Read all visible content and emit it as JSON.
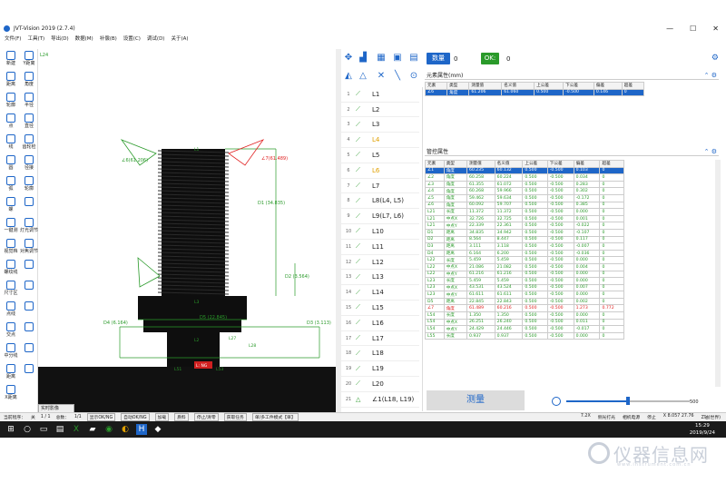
{
  "app": {
    "title": "JVT-Vision 2019   (2.7.4)",
    "window_controls": [
      "—",
      "☐",
      "✕"
    ]
  },
  "menu": [
    "文件(F)",
    "工具(T)",
    "导出(D)",
    "数据(M)",
    "补偿(B)",
    "设置(C)",
    "调试(D)",
    "关于(A)"
  ],
  "left_tools": [
    {
      "label": "新建",
      "icon": "new-icon"
    },
    {
      "label": "Y距离",
      "icon": "y-distance-icon"
    },
    {
      "label": "距离",
      "icon": "distance-icon"
    },
    {
      "label": "角度",
      "icon": "angle-icon"
    },
    {
      "label": "轮廓",
      "icon": "contour-icon"
    },
    {
      "label": "半径",
      "icon": "radius-icon"
    },
    {
      "label": "点",
      "icon": "point-icon"
    },
    {
      "label": "直径",
      "icon": "diameter-icon"
    },
    {
      "label": "线",
      "icon": "line-icon"
    },
    {
      "label": "齿轮检",
      "icon": "gear-check-icon"
    },
    {
      "label": "圆",
      "icon": "circle-icon"
    },
    {
      "label": "径接",
      "icon": "tangent-icon"
    },
    {
      "label": "弧",
      "icon": "arc-icon"
    },
    {
      "label": "轮廓",
      "icon": "profile-icon"
    },
    {
      "label": "螺",
      "icon": "thread-icon"
    },
    {
      "label": "",
      "icon": "blank-icon"
    },
    {
      "label": "一键测",
      "icon": "one-click-icon"
    },
    {
      "label": "灯光调节",
      "icon": "light-icon"
    },
    {
      "label": "视觉档",
      "icon": "visual-icon"
    },
    {
      "label": "对焦调节",
      "icon": "focus-icon"
    },
    {
      "label": "螺纹线",
      "icon": "thread-line-icon"
    },
    {
      "label": "",
      "icon": "chart-icon"
    },
    {
      "label": "尺寸区",
      "icon": "dimension-area-icon"
    },
    {
      "label": "",
      "icon": "x-icon"
    },
    {
      "label": "点线",
      "icon": "dotline-icon"
    },
    {
      "label": "",
      "icon": "x2-icon"
    },
    {
      "label": "交点",
      "icon": "intersect-icon"
    },
    {
      "label": "",
      "icon": "blank2-icon"
    },
    {
      "label": "中分线",
      "icon": "bisector-icon"
    },
    {
      "label": "",
      "icon": "blank3-icon"
    },
    {
      "label": "距离",
      "icon": "distance2-icon"
    },
    {
      "label": "",
      "icon": "blank4-icon"
    },
    {
      "label": "X距离",
      "icon": "x-distance-icon"
    }
  ],
  "view": {
    "corner_label": "L24",
    "annotations": [
      {
        "t": "∠6(61.206)",
        "c": "#2a9a2a"
      },
      {
        "t": "∠7(61.489)",
        "c": "#e02020"
      },
      {
        "t": "D1 (34.835)",
        "c": "#2a9a2a"
      },
      {
        "t": "D2 (3.564)",
        "c": "#2a9a2a"
      },
      {
        "t": "D4 (6.164)",
        "c": "#2a9a2a"
      },
      {
        "t": "D3 (3.113)",
        "c": "#2a9a2a"
      },
      {
        "t": "D5 (22.845)",
        "c": "#2a9a2a"
      },
      {
        "t": "L1",
        "c": "#2a9a2a"
      },
      {
        "t": "L2",
        "c": "#2a9a2a"
      },
      {
        "t": "L3",
        "c": "#2a9a2a"
      },
      {
        "t": "L51",
        "c": "#2a9a2a"
      },
      {
        "t": "L53",
        "c": "#2a9a2a"
      },
      {
        "t": "L27",
        "c": "#2a9a2a"
      },
      {
        "t": "L28",
        "c": "#2a9a2a"
      }
    ],
    "ng_label": "L:  NG",
    "live_label": "实时影像"
  },
  "list_items": [
    {
      "n": "1",
      "label": "L1",
      "hl": false,
      "icon": "⟋"
    },
    {
      "n": "2",
      "label": "L2",
      "hl": false,
      "icon": "⟋"
    },
    {
      "n": "3",
      "label": "L3",
      "hl": false,
      "icon": "⟋"
    },
    {
      "n": "4",
      "label": "L4",
      "hl": true,
      "icon": "⟋"
    },
    {
      "n": "5",
      "label": "L5",
      "hl": false,
      "icon": "⟋"
    },
    {
      "n": "6",
      "label": "L6",
      "hl": true,
      "icon": "⟋"
    },
    {
      "n": "7",
      "label": "L7",
      "hl": false,
      "icon": "⟋"
    },
    {
      "n": "8",
      "label": "L8(L4,  L5)",
      "hl": false,
      "icon": "⟋"
    },
    {
      "n": "9",
      "label": "L9(L7,  L6)",
      "hl": false,
      "icon": "⟋"
    },
    {
      "n": "10",
      "label": "L10",
      "hl": false,
      "icon": "⟋"
    },
    {
      "n": "11",
      "label": "L11",
      "hl": false,
      "icon": "⟋"
    },
    {
      "n": "12",
      "label": "L12",
      "hl": false,
      "icon": "⟋"
    },
    {
      "n": "13",
      "label": "L13",
      "hl": false,
      "icon": "⟋"
    },
    {
      "n": "14",
      "label": "L14",
      "hl": false,
      "icon": "⟋"
    },
    {
      "n": "15",
      "label": "L15",
      "hl": false,
      "icon": "⟋"
    },
    {
      "n": "16",
      "label": "L16",
      "hl": false,
      "icon": "⟋"
    },
    {
      "n": "17",
      "label": "L17",
      "hl": false,
      "icon": "⟋"
    },
    {
      "n": "18",
      "label": "L18",
      "hl": false,
      "icon": "⟋"
    },
    {
      "n": "19",
      "label": "L19",
      "hl": false,
      "icon": "⟋"
    },
    {
      "n": "20",
      "label": "L20",
      "hl": false,
      "icon": "⟋"
    },
    {
      "n": "21",
      "label": "∠1(L18,  L19)",
      "hl": false,
      "icon": "△"
    }
  ],
  "top": {
    "ng_label": "数量",
    "ng_count": "0",
    "ok_label": "OK:",
    "ok_count": "0"
  },
  "panelA": {
    "title": "元素属性(mm)",
    "headers": [
      "元素",
      "类型",
      "测量值",
      "名义值",
      "上公差",
      "下公差",
      "偏差",
      "超差"
    ],
    "rows": [
      [
        "∠6",
        "角度",
        "61.206",
        "61.060",
        "0.500",
        "-0.500",
        "0.146",
        "0"
      ]
    ]
  },
  "panelB": {
    "title": "管控属性",
    "headers": [
      "元素",
      "类型",
      "测量值",
      "名义值",
      "上公差",
      "下公差",
      "偏差",
      "超差"
    ],
    "rows": [
      [
        "∠1",
        "角度",
        "60.235",
        "60.132",
        "0.500",
        "-0.500",
        "0.103",
        "0"
      ],
      [
        "∠2",
        "角度",
        "60.258",
        "60.224",
        "0.500",
        "-0.500",
        "0.034",
        "0"
      ],
      [
        "∠3",
        "角度",
        "61.355",
        "61.072",
        "0.500",
        "-0.500",
        "0.283",
        "0"
      ],
      [
        "∠4",
        "角度",
        "60.268",
        "59.966",
        "0.500",
        "-0.500",
        "0.302",
        "0"
      ],
      [
        "∠5",
        "角度",
        "59.462",
        "59.634",
        "0.500",
        "-0.500",
        "-0.172",
        "0"
      ],
      [
        "∠6",
        "角度",
        "60.092",
        "59.707",
        "0.500",
        "-0.500",
        "0.385",
        "0"
      ],
      [
        "L21",
        "长度",
        "11.372",
        "11.372",
        "0.500",
        "-0.500",
        "0.000",
        "0"
      ],
      [
        "L21",
        "中点X",
        "32.726",
        "32.725",
        "0.500",
        "-0.500",
        "0.001",
        "0"
      ],
      [
        "L21",
        "中点Y",
        "22.339",
        "22.361",
        "0.500",
        "-0.500",
        "-0.022",
        "0"
      ],
      [
        "D1",
        "距离",
        "34.835",
        "34.942",
        "0.500",
        "-0.500",
        "-0.107",
        "0"
      ],
      [
        "D2",
        "距离",
        "8.564",
        "8.447",
        "0.500",
        "-0.500",
        "0.117",
        "0"
      ],
      [
        "D3",
        "距离",
        "3.111",
        "3.118",
        "0.500",
        "-0.500",
        "-0.007",
        "0"
      ],
      [
        "D4",
        "距离",
        "6.164",
        "6.200",
        "0.500",
        "-0.500",
        "-0.036",
        "0"
      ],
      [
        "L22",
        "长度",
        "5.459",
        "5.459",
        "0.500",
        "-0.500",
        "0.000",
        "0"
      ],
      [
        "L22",
        "中点X",
        "21.086",
        "21.082",
        "0.500",
        "-0.500",
        "0.004",
        "0"
      ],
      [
        "L22",
        "中点Y",
        "61.216",
        "61.216",
        "0.500",
        "-0.500",
        "0.000",
        "0"
      ],
      [
        "L23",
        "长度",
        "5.459",
        "5.459",
        "0.500",
        "-0.500",
        "0.000",
        "0"
      ],
      [
        "L23",
        "中点X",
        "43.531",
        "43.524",
        "0.500",
        "-0.500",
        "0.007",
        "0"
      ],
      [
        "L23",
        "中点Y",
        "61.611",
        "61.611",
        "0.500",
        "-0.500",
        "0.000",
        "0"
      ],
      [
        "D5",
        "距离",
        "22.845",
        "22.843",
        "0.500",
        "-0.500",
        "0.002",
        "0"
      ],
      [
        "∠7",
        "角度",
        "61.489",
        "60.216",
        "0.500",
        "-0.500",
        "1.273",
        "0.772"
      ],
      [
        "L54",
        "长度",
        "1.350",
        "1.350",
        "0.500",
        "-0.500",
        "0.000",
        "0"
      ],
      [
        "L54",
        "中点X",
        "26.251",
        "26.240",
        "0.500",
        "-0.500",
        "0.011",
        "0"
      ],
      [
        "L54",
        "中点Y",
        "24.429",
        "24.446",
        "0.500",
        "-0.500",
        "-0.017",
        "0"
      ],
      [
        "L55",
        "长度",
        "0.937",
        "0.937",
        "0.500",
        "-0.500",
        "0.000",
        "0"
      ]
    ]
  },
  "measure_btn": "测量",
  "slider": {
    "value": "500"
  },
  "status": {
    "left": [
      "当前程序：",
      "关",
      "1 / 1",
      "总数：",
      "1/1"
    ],
    "btns": [
      "显示OK/NG",
      "自动OK/NG",
      "加载",
      "质料",
      "停止/清零",
      "获取任务",
      "单/多工件模式【单】"
    ],
    "right": [
      "7.2X",
      "侧光打光",
      "相机电源",
      "停止",
      "X 8.057 27.76",
      "Z轴(世界)"
    ]
  },
  "taskbar": {
    "time": "15:29",
    "date": "2019/9/24"
  },
  "watermark": {
    "text": "仪器信息网",
    "sub": "www.instrument.com.cn"
  }
}
